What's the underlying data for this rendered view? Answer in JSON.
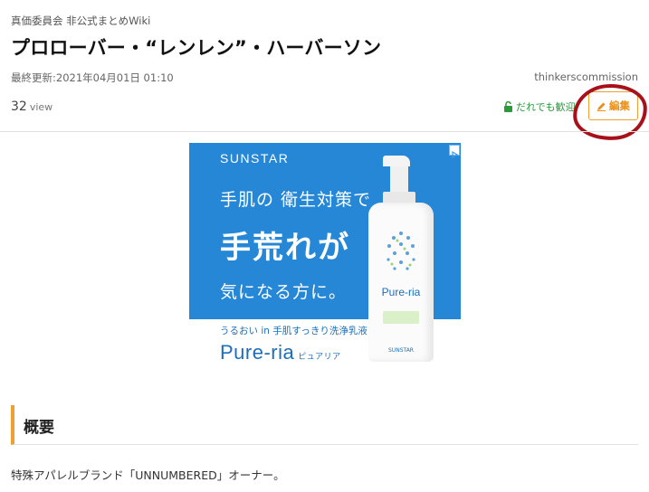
{
  "header": {
    "wiki_name": "真価委員会 非公式まとめWiki",
    "page_title": "プロローバー・“レンレン”・ハーバーソン",
    "last_updated": "最終更新:2021年04月01日 01:10",
    "author": "thinkerscommission",
    "view_count": "32",
    "view_unit": "view",
    "permission": "だれでも歓迎",
    "edit_label": "編集"
  },
  "ad": {
    "brand": "SUNSTAR",
    "line1": "手肌の 衛生対策で",
    "line2": "手荒れが",
    "line3": "気になる方に。",
    "tagline": "うるおい in 手肌すっきり洗浄乳液",
    "product": "Pure-ria",
    "product_kana": "ピュアリア",
    "bottle_name": "Pure-ria",
    "bottle_brand": "SUNSTAR"
  },
  "content": {
    "section_heading": "概要",
    "body_text": "特殊アパレルブランド「UNNUMBERED」オーナー。"
  },
  "colors": {
    "accent": "#f0a030",
    "annotation": "#a8101a",
    "ad_blue": "#2587d6",
    "permission_green": "#2c9a3c"
  }
}
